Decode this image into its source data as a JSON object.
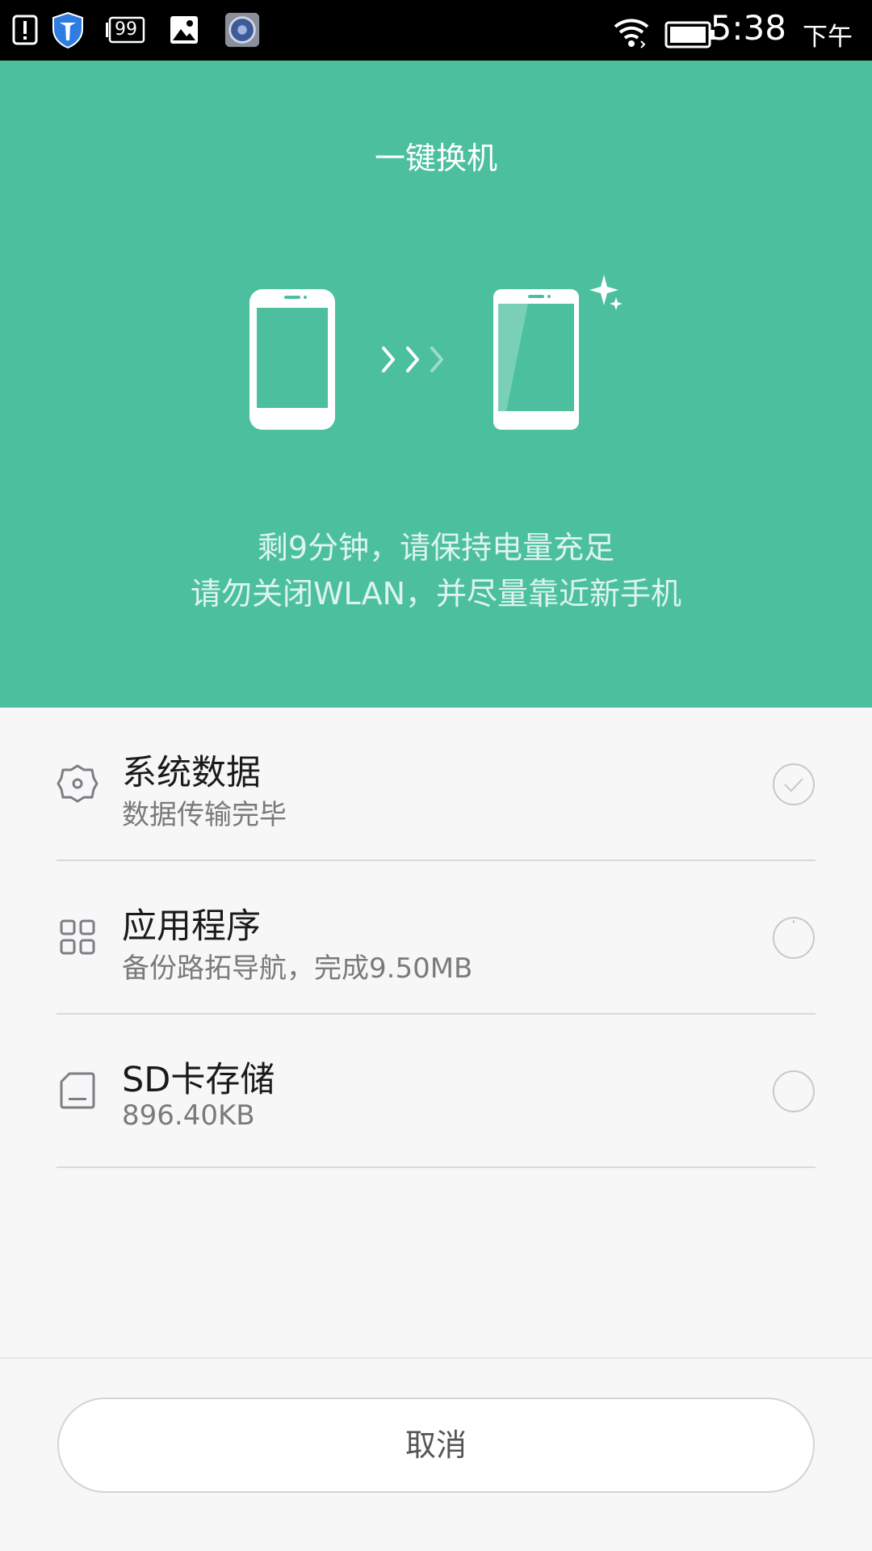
{
  "status_bar": {
    "time": "5:38",
    "ampm": "下午",
    "notification_badge": "99",
    "icons": [
      "alert-icon",
      "shield-icon",
      "message-count-icon",
      "image-icon",
      "app-icon",
      "wifi-icon",
      "battery-icon"
    ]
  },
  "hero": {
    "title": "一键换机",
    "line1": "剩9分钟，请保持电量充足",
    "line2": "请勿关闭WLAN，并尽量靠近新手机",
    "background_color": "#4cc09e"
  },
  "items": [
    {
      "title": "系统数据",
      "subtitle": "数据传输完毕",
      "icon": "gear-icon",
      "status": "done"
    },
    {
      "title": "应用程序",
      "subtitle": "备份路拓导航，完成9.50MB",
      "icon": "apps-grid-icon",
      "status": "in-progress"
    },
    {
      "title": "SD卡存储",
      "subtitle": "896.40KB",
      "icon": "sd-card-icon",
      "status": "pending"
    }
  ],
  "cancel_label": "取消"
}
